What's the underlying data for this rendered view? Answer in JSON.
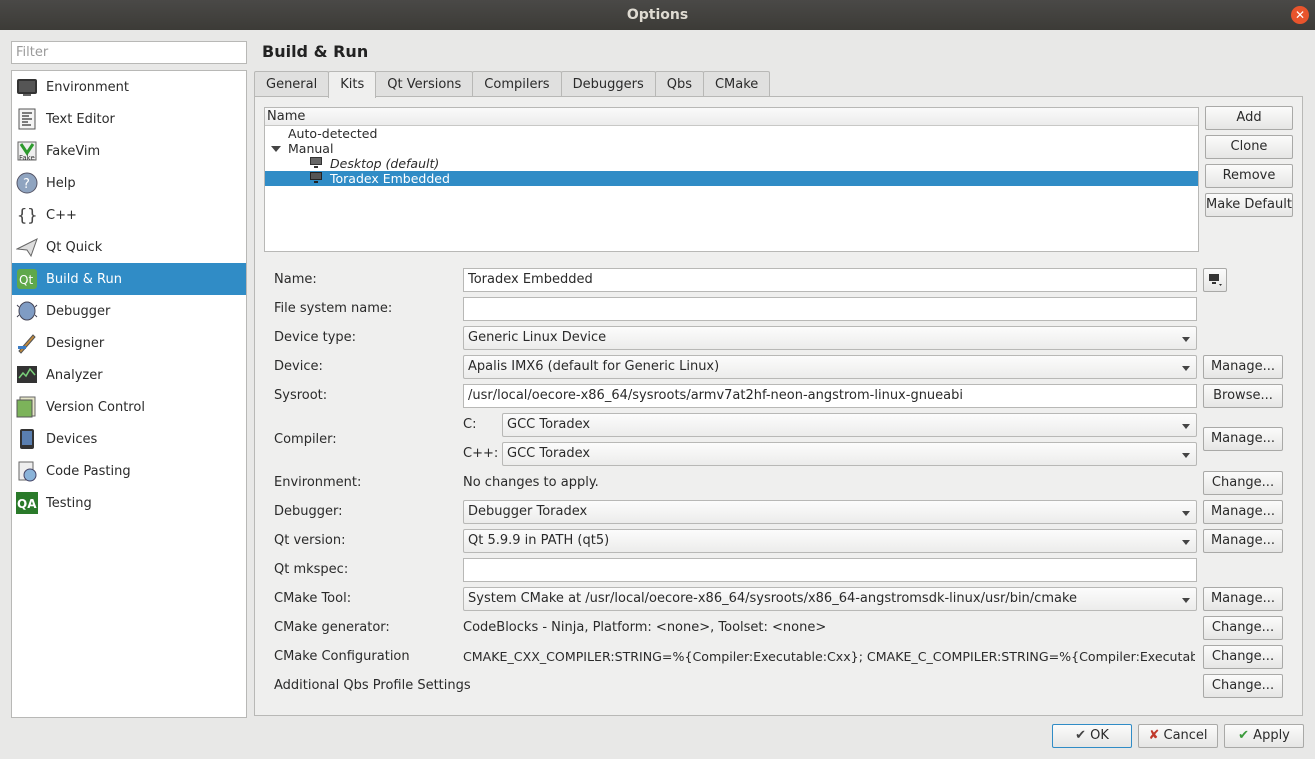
{
  "window": {
    "title": "Options"
  },
  "filter": {
    "placeholder": "Filter"
  },
  "sidebar": {
    "items": [
      {
        "label": "Environment",
        "icon": "monitor-icon"
      },
      {
        "label": "Text Editor",
        "icon": "text-editor-icon"
      },
      {
        "label": "FakeVim",
        "icon": "fakevim-icon"
      },
      {
        "label": "Help",
        "icon": "help-icon"
      },
      {
        "label": "C++",
        "icon": "cpp-braces-icon"
      },
      {
        "label": "Qt Quick",
        "icon": "paper-plane-icon"
      },
      {
        "label": "Build & Run",
        "icon": "qt-build-icon",
        "selected": true
      },
      {
        "label": "Debugger",
        "icon": "debugger-bug-icon"
      },
      {
        "label": "Designer",
        "icon": "designer-brush-icon"
      },
      {
        "label": "Analyzer",
        "icon": "analyzer-icon"
      },
      {
        "label": "Version Control",
        "icon": "version-control-icon"
      },
      {
        "label": "Devices",
        "icon": "device-icon"
      },
      {
        "label": "Code Pasting",
        "icon": "code-pasting-icon"
      },
      {
        "label": "Testing",
        "icon": "qa-testing-icon"
      }
    ]
  },
  "page": {
    "title": "Build & Run"
  },
  "tabs": [
    {
      "label": "General"
    },
    {
      "label": "Kits",
      "active": true
    },
    {
      "label": "Qt Versions"
    },
    {
      "label": "Compilers"
    },
    {
      "label": "Debuggers"
    },
    {
      "label": "Qbs"
    },
    {
      "label": "CMake"
    }
  ],
  "kits_tree": {
    "header": "Name",
    "auto_detected": "Auto-detected",
    "manual": "Manual",
    "kits": [
      {
        "label": "Desktop (default)",
        "italic": true
      },
      {
        "label": "Toradex Embedded",
        "selected": true
      }
    ]
  },
  "kit_buttons": {
    "add": "Add",
    "clone": "Clone",
    "remove": "Remove",
    "make_default": "Make Default"
  },
  "form": {
    "name": {
      "label": "Name:",
      "value": "Toradex Embedded"
    },
    "fs_name": {
      "label": "File system name:",
      "value": ""
    },
    "device_type": {
      "label": "Device type:",
      "value": "Generic Linux Device"
    },
    "device": {
      "label": "Device:",
      "value": "Apalis IMX6 (default for Generic Linux)"
    },
    "sysroot": {
      "label": "Sysroot:",
      "value": "/usr/local/oecore-x86_64/sysroots/armv7at2hf-neon-angstrom-linux-gnueabi"
    },
    "compiler": {
      "label": "Compiler:",
      "c_label": "C:",
      "c_value": "GCC Toradex",
      "cpp_label": "C++:",
      "cpp_value": "GCC Toradex"
    },
    "environment": {
      "label": "Environment:",
      "value": "No changes to apply."
    },
    "debugger": {
      "label": "Debugger:",
      "value": "Debugger Toradex"
    },
    "qt_version": {
      "label": "Qt version:",
      "value": "Qt 5.9.9 in PATH (qt5)"
    },
    "qt_mkspec": {
      "label": "Qt mkspec:",
      "value": ""
    },
    "cmake_tool": {
      "label": "CMake Tool:",
      "value": "System CMake at /usr/local/oecore-x86_64/sysroots/x86_64-angstromsdk-linux/usr/bin/cmake"
    },
    "cmake_generator": {
      "label": "CMake generator:",
      "value": "CodeBlocks - Ninja, Platform: <none>, Toolset: <none>"
    },
    "cmake_config": {
      "label": "CMake Configuration",
      "value": "CMAKE_CXX_COMPILER:STRING=%{Compiler:Executable:Cxx}; CMAKE_C_COMPILER:STRING=%{Compiler:Executable:…"
    },
    "qbs_profile": {
      "label": "Additional Qbs Profile Settings"
    }
  },
  "side_buttons": {
    "manage": "Manage...",
    "browse": "Browse...",
    "change": "Change..."
  },
  "dialog_buttons": {
    "ok": "OK",
    "cancel": "Cancel",
    "apply": "Apply"
  }
}
